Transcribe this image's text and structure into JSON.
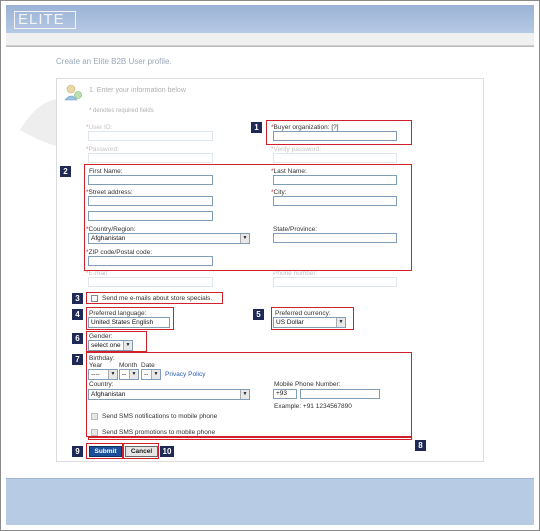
{
  "header": {
    "logo": "ELITE"
  },
  "page": {
    "title": "Create an Elite B2B User profile."
  },
  "step": {
    "title": "1. Enter your information below",
    "required_note": "denotes required fields"
  },
  "fields": {
    "user_id": "User ID:",
    "buyer_org": "Buyer organization: [?]",
    "password": "Password:",
    "verify_password": "Verify password:",
    "first_name": "First Name:",
    "last_name": "Last Name:",
    "street": "Street address:",
    "city": "City:",
    "country_region": "Country/Region:",
    "country_region_value": "Afghanistan",
    "state": "State/Province:",
    "zip": "ZIP code/Postal code:",
    "email": "E-mail:",
    "phone": "Phone number:",
    "send_emails": "Send me e-mails about store specials.",
    "pref_language": "Preferred language:",
    "pref_language_value": "United States English",
    "pref_currency": "Preferred currency:",
    "pref_currency_value": "US Dollar",
    "gender": "Gender:",
    "gender_value": "select one",
    "birthday": "Birthday:",
    "year": "Year",
    "month": "Month",
    "date": "Date",
    "year_value": "----",
    "month_value": "--",
    "date_value": "--",
    "privacy": "Privacy Policy",
    "country": "Country:",
    "country_value": "Afghanistan",
    "mobile": "Mobile Phone Number:",
    "mobile_code": "+93",
    "example": "Example: +91 1234567890",
    "sms_notifications": "Send SMS notifications to mobile phone",
    "sms_promotions": "Send SMS promotions to mobile phone"
  },
  "buttons": {
    "submit": "Submit",
    "cancel": "Cancel"
  },
  "badges": [
    "1",
    "2",
    "3",
    "4",
    "5",
    "6",
    "7",
    "8",
    "9",
    "10"
  ],
  "colors": {
    "highlight": "#d0202a",
    "badge": "#1e2a55",
    "submit": "#1b4f9a",
    "header": "#9ab3d6",
    "footer": "#b7cbe5"
  }
}
